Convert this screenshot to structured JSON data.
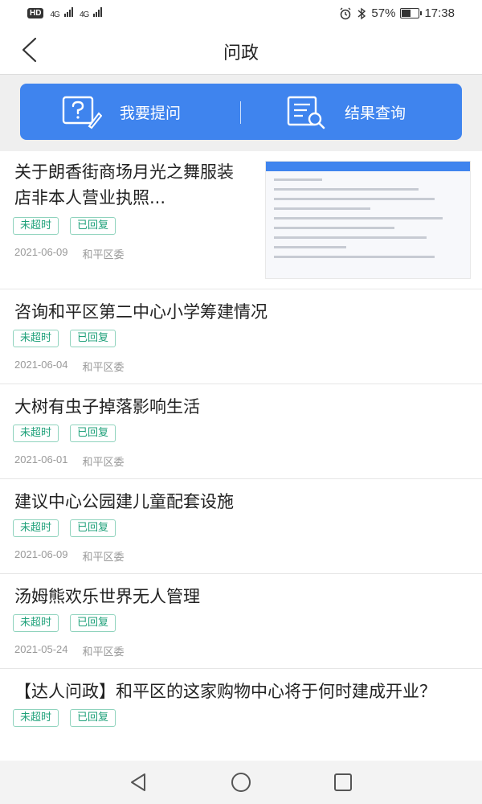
{
  "status_bar": {
    "hd": "HD",
    "net1": "4G",
    "net2": "4G",
    "battery_percent": "57%",
    "time": "17:38"
  },
  "nav": {
    "title": "问政"
  },
  "banner": {
    "ask_label": "我要提问",
    "query_label": "结果查询",
    "color": "#3f84ee"
  },
  "list": [
    {
      "title": "关于朗香街商场月光之舞服装店非本人营业执照...",
      "tags": [
        "未超时",
        "已回复"
      ],
      "date": "2021-06-09",
      "dept": "和平区委"
    },
    {
      "title": "咨询和平区第二中心小学筹建情况",
      "tags": [
        "未超时",
        "已回复"
      ],
      "date": "2021-06-04",
      "dept": "和平区委"
    },
    {
      "title": "大树有虫子掉落影响生活",
      "tags": [
        "未超时",
        "已回复"
      ],
      "date": "2021-06-01",
      "dept": "和平区委"
    },
    {
      "title": "建议中心公园建儿童配套设施",
      "tags": [
        "未超时",
        "已回复"
      ],
      "date": "2021-06-09",
      "dept": "和平区委"
    },
    {
      "title": "汤姆熊欢乐世界无人管理",
      "tags": [
        "未超时",
        "已回复"
      ],
      "date": "2021-05-24",
      "dept": "和平区委"
    },
    {
      "title": "【达人问政】和平区的这家购物中心将于何时建成开业？",
      "tags": [
        "未超时",
        "已回复"
      ]
    }
  ]
}
